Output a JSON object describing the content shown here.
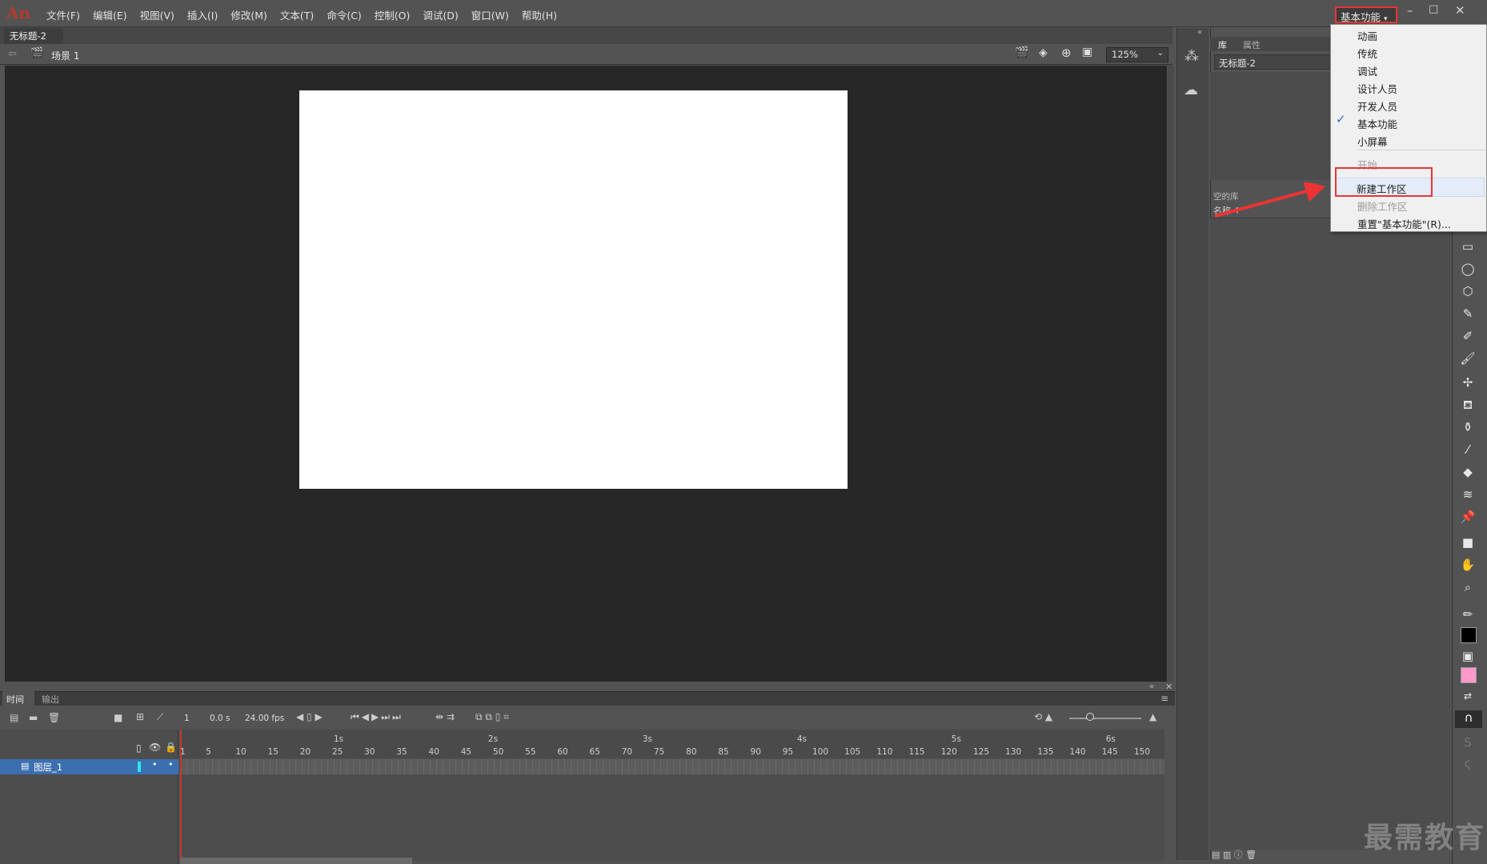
{
  "app": {
    "logo_text": "An"
  },
  "menubar": {
    "items": [
      "文件(F)",
      "编辑(E)",
      "视图(V)",
      "插入(I)",
      "修改(M)",
      "文本(T)",
      "命令(C)",
      "控制(O)",
      "调试(D)",
      "窗口(W)",
      "帮助(H)"
    ],
    "workspace_label": "基本功能"
  },
  "document": {
    "tab_title": "无标题-2",
    "tab_close": "×",
    "scene_label": "场景 1"
  },
  "editbar": {
    "zoom": "125%"
  },
  "library": {
    "tab_library": "库",
    "tab_properties": "属性",
    "doc_select": "无标题-2",
    "empty_label": "空的库",
    "name_header": "名称 ↑"
  },
  "workspace_menu": {
    "items": [
      "动画",
      "传统",
      "调试",
      "设计人员",
      "开发人员",
      "基本功能",
      "小屏幕"
    ],
    "checked": "基本功能",
    "disabled_start": "开始",
    "new_workspace": "新建工作区",
    "delete_workspace": "删除工作区",
    "reset_workspace": "重置\"基本功能\"(R)..."
  },
  "timeline": {
    "tab_timeline": "时间轴",
    "tab_output": "输出",
    "current_frame": "1",
    "elapsed": "0.0 s",
    "fps": "24.00 fps",
    "layer_name": "图层_1",
    "seconds": [
      "1s",
      "2s",
      "3s",
      "4s",
      "5s",
      "6s"
    ],
    "frame_ticks": [
      "1",
      "5",
      "10",
      "15",
      "20",
      "25",
      "30",
      "35",
      "40",
      "45",
      "50",
      "55",
      "60",
      "65",
      "70",
      "75",
      "80",
      "85",
      "90",
      "95",
      "100",
      "105",
      "110",
      "115",
      "120",
      "125",
      "130",
      "135",
      "140",
      "145",
      "150"
    ]
  },
  "watermark": "最需教育",
  "colors": {
    "stage_bg": "#272727",
    "stroke_swatch": "#000000",
    "fill_swatch": "#ff99cc",
    "highlight": "#e33333"
  }
}
